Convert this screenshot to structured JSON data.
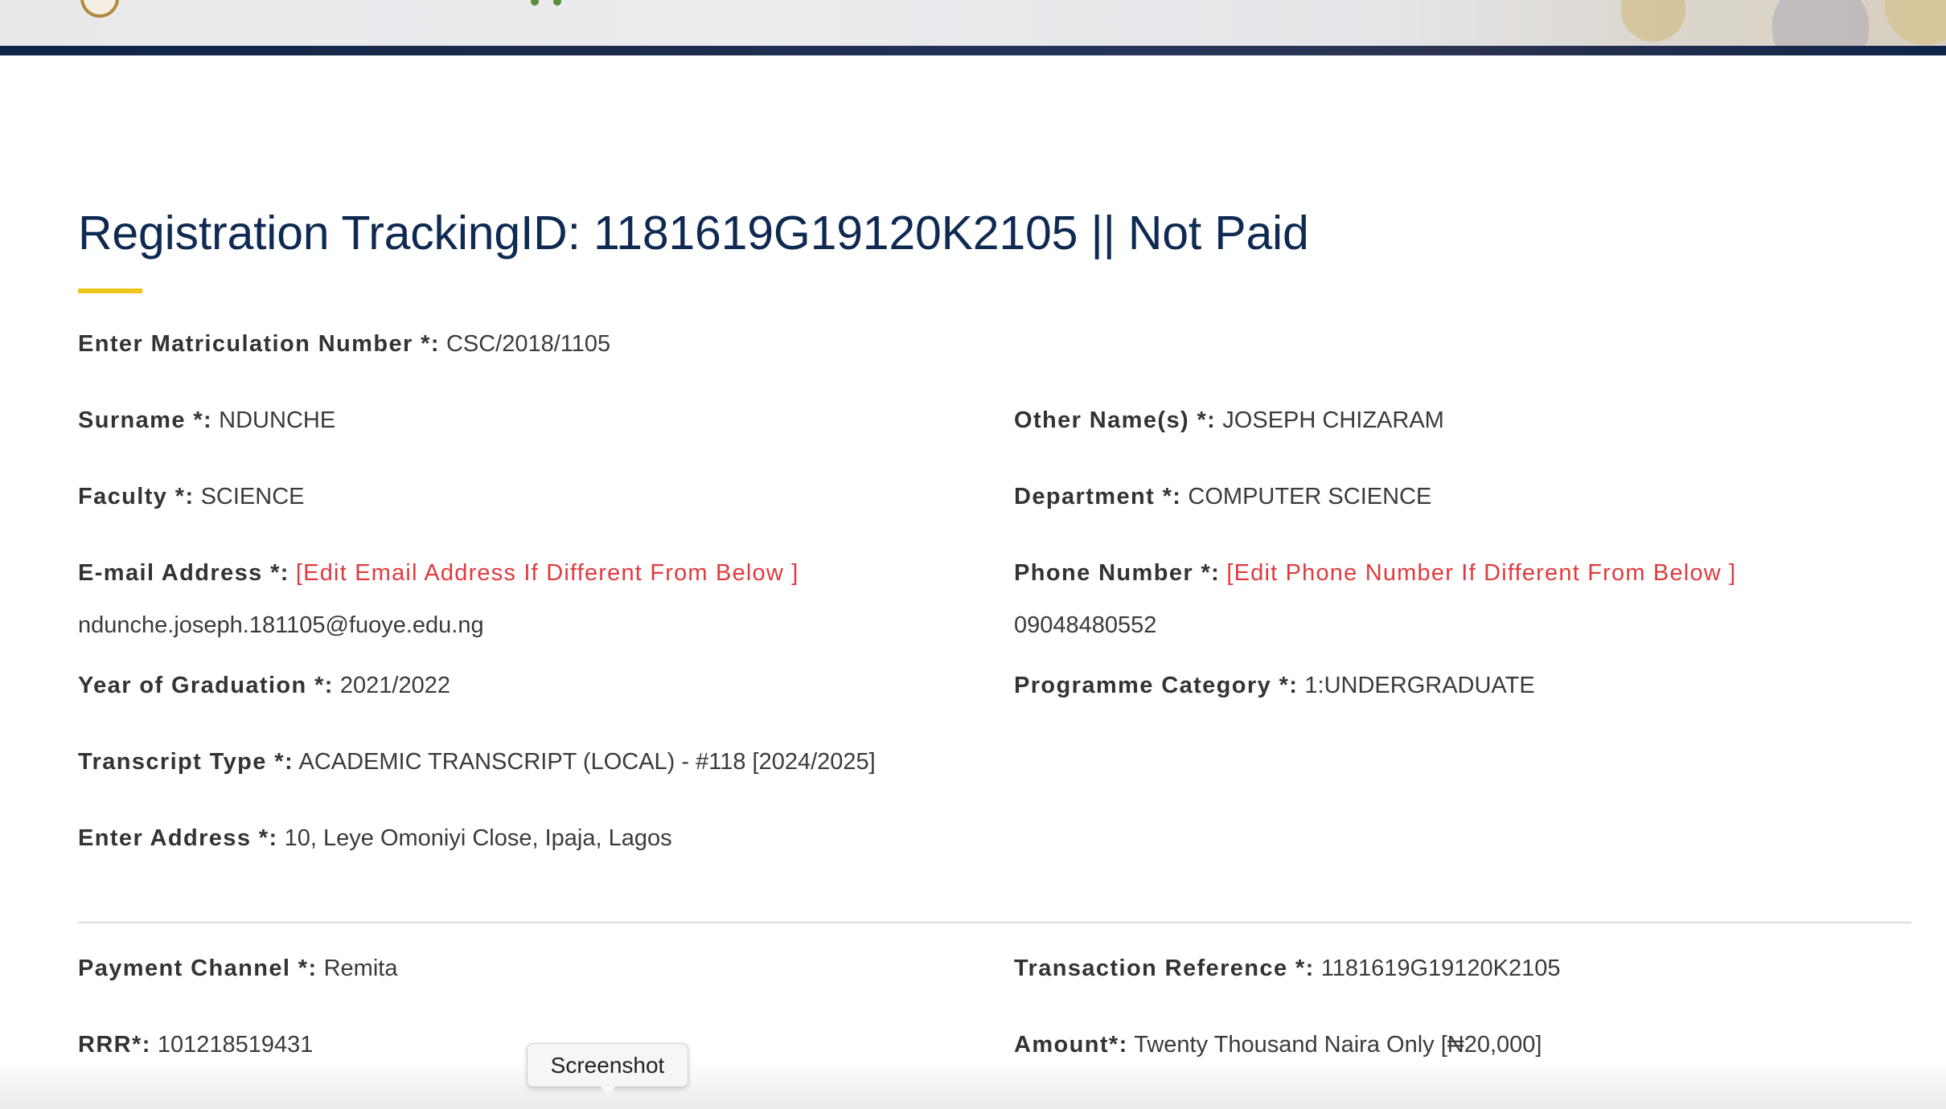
{
  "page": {
    "title": "Registration TrackingID: 1181619G19120K2105 || Not Paid"
  },
  "form": {
    "matric": {
      "label": "Enter Matriculation Number *:",
      "value": "CSC/2018/1105"
    },
    "surname": {
      "label": "Surname *:",
      "value": "NDUNCHE"
    },
    "other_names": {
      "label": "Other Name(s) *:",
      "value": "JOSEPH CHIZARAM"
    },
    "faculty": {
      "label": "Faculty *:",
      "value": "SCIENCE"
    },
    "department": {
      "label": "Department *:",
      "value": "COMPUTER SCIENCE"
    },
    "email": {
      "label": "E-mail Address *:",
      "edit_link": "[Edit Email Address If Different From Below ]",
      "value": "ndunche.joseph.181105@fuoye.edu.ng"
    },
    "phone": {
      "label": "Phone Number *:",
      "edit_link": "[Edit Phone Number If Different From Below ]",
      "value": "09048480552"
    },
    "graduation_year": {
      "label": "Year of Graduation *:",
      "value": "2021/2022"
    },
    "programme_category": {
      "label": "Programme Category *:",
      "value": "1:UNDERGRADUATE"
    },
    "transcript_type": {
      "label": "Transcript Type *:",
      "value": "ACADEMIC TRANSCRIPT (LOCAL) - #118 [2024/2025]"
    },
    "address": {
      "label": "Enter Address *:",
      "value": "10, Leye Omoniyi Close, Ipaja, Lagos"
    }
  },
  "payment": {
    "channel": {
      "label": "Payment Channel *:",
      "value": "Remita"
    },
    "transaction_ref": {
      "label": "Transaction Reference *:",
      "value": "1181619G19120K2105"
    },
    "rrr": {
      "label": "RRR*:",
      "value": "101218519431"
    },
    "amount": {
      "label": "Amount*:",
      "value": "Twenty Thousand Naira Only [₦20,000]"
    }
  },
  "tooltip": {
    "text": "Screenshot"
  },
  "colors": {
    "title": "#0f2a52",
    "accent_underline": "#f0c419",
    "edit_link": "#e03a3e",
    "header_bar": "#0f2447"
  }
}
